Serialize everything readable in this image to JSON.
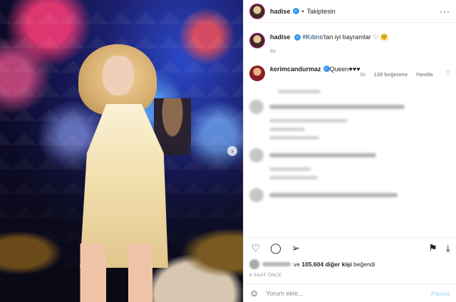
{
  "header": {
    "username": "hadise",
    "separator": "•",
    "follow_status": "Takiptesin",
    "more": "···"
  },
  "caption": {
    "username": "hadise",
    "hashtag": "#Kıbrıs",
    "text": "'tan iyi bayramlar ♡ 🤗",
    "time": "6s"
  },
  "top_comment": {
    "username": "kerimcandurmaz",
    "text": "Queen♥♥♥",
    "time": "6s",
    "likes": "139 beğenme",
    "reply": "Yanıtla"
  },
  "likes_line": {
    "connector": "ve",
    "count": "105.604 diğer kişi",
    "suffix": "beğendi"
  },
  "timestamp": "6 SAAT ÖNCE",
  "add_comment": {
    "placeholder": "Yorum ekle...",
    "post_label": "Paylaş"
  },
  "icons": {
    "more": "more-icon",
    "like": "heart-icon",
    "comment": "comment-icon",
    "share": "send-icon",
    "save": "bookmark-icon",
    "download": "download-icon",
    "emoji": "smiley-icon",
    "next": "chevron-right-icon"
  },
  "colors": {
    "verified": "#3897f0",
    "link": "#00376b",
    "post_button": "#b2dffc"
  }
}
